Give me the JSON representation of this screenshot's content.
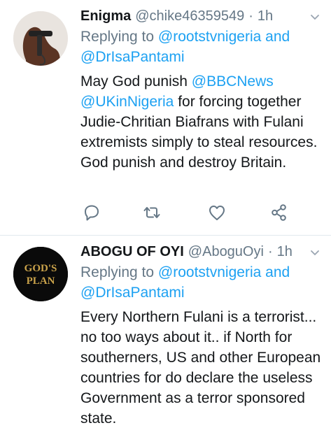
{
  "tweets": [
    {
      "name": "Enigma",
      "handle": "@chike46359549",
      "dot": "·",
      "time": "1h",
      "reply_prefix": "Replying to",
      "reply_to_1": "@rootstvnigeria",
      "reply_and": "and",
      "reply_to_2": "@DrIsaPantami",
      "text_1": "May God punish",
      "mention_1": "@BBCNews",
      "mention_2": "@UKinNigeria",
      "text_2": "for forcing together Judie-Chritian Biafrans with Fulani extremists simply to steal resources. God punish and destroy Britain."
    },
    {
      "name": "ABOGU OF OYI",
      "handle": "@AboguOyi",
      "dot": "·",
      "time": "1h",
      "reply_prefix": "Replying to",
      "reply_to_1": "@rootstvnigeria",
      "reply_and": "and",
      "reply_to_2": "@DrIsaPantami",
      "text": "Every Northern Fulani is a terrorist... no too ways about it.. if North for southerners, US and other European countries for do declare the useless Government as a terror sponsored state.",
      "avatar_text_1": "GOD'S",
      "avatar_text_2": "PLAN"
    }
  ],
  "icons": [
    "reply-icon",
    "retweet-icon",
    "like-icon",
    "share-icon",
    "chevron-down-icon"
  ],
  "colors": {
    "accent": "#1da1f2",
    "muted": "#657786",
    "text": "#14171a",
    "divider": "#e1e8ed"
  }
}
